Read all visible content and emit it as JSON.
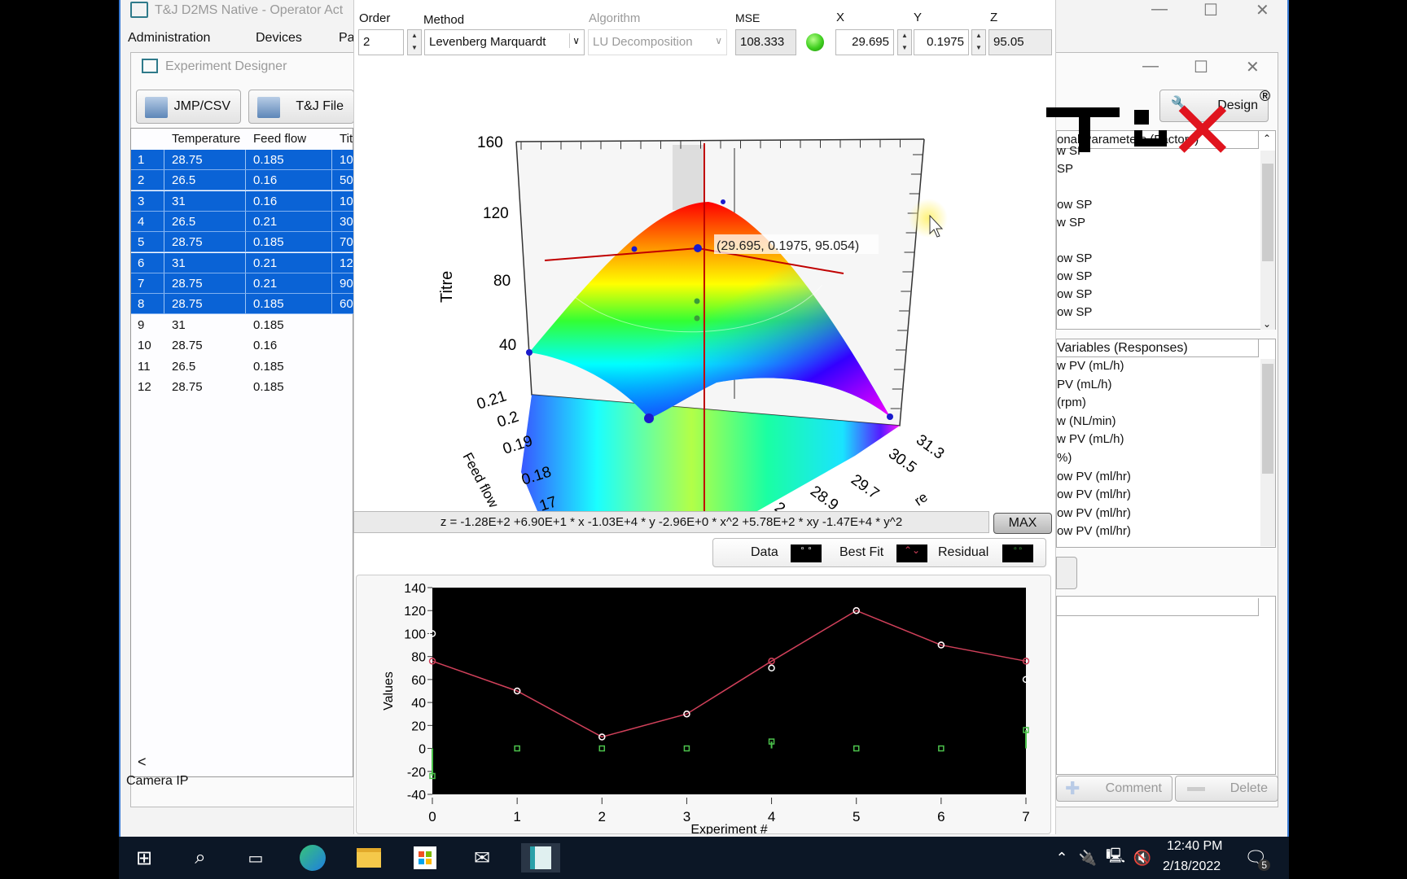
{
  "main_window": {
    "title": "T&J D2MS Native  - Operator Act",
    "menu": [
      "Administration",
      "Devices",
      "Pa"
    ],
    "camera_label": "Camera IP"
  },
  "designer": {
    "title": "Experiment Designer",
    "buttons": [
      "JMP/CSV",
      "T&J File"
    ],
    "columns": [
      "",
      "Temperature",
      "Feed flow",
      "Tit"
    ],
    "rows": [
      {
        "n": "1",
        "t": "28.75",
        "f": "0.185",
        "z": "10",
        "selected": true
      },
      {
        "n": "2",
        "t": "26.5",
        "f": "0.16",
        "z": "50",
        "selected": true
      },
      {
        "n": "3",
        "t": "31",
        "f": "0.16",
        "z": "10",
        "selected": true
      },
      {
        "n": "4",
        "t": "26.5",
        "f": "0.21",
        "z": "30",
        "selected": true
      },
      {
        "n": "5",
        "t": "28.75",
        "f": "0.185",
        "z": "70",
        "selected": true
      },
      {
        "n": "6",
        "t": "31",
        "f": "0.21",
        "z": "12",
        "selected": true
      },
      {
        "n": "7",
        "t": "28.75",
        "f": "0.21",
        "z": "90",
        "selected": true
      },
      {
        "n": "8",
        "t": "28.75",
        "f": "0.185",
        "z": "60",
        "selected": true
      },
      {
        "n": "9",
        "t": "31",
        "f": "0.185",
        "z": "",
        "selected": false
      },
      {
        "n": "10",
        "t": "28.75",
        "f": "0.16",
        "z": "",
        "selected": false
      },
      {
        "n": "11",
        "t": "26.5",
        "f": "0.185",
        "z": "",
        "selected": false
      },
      {
        "n": "12",
        "t": "28.75",
        "f": "0.185",
        "z": "",
        "selected": false
      }
    ],
    "scroll_left": "<"
  },
  "fit": {
    "order_label": "Order",
    "order": "2",
    "method_label": "Method",
    "method": "Levenberg Marquardt",
    "algorithm_label": "Algorithm",
    "algorithm": "LU Decomposition",
    "mse_label": "MSE",
    "mse": "108.333",
    "status_color": "#3fcf1f",
    "x_label": "X",
    "x": "29.695",
    "y_label": "Y",
    "y": "0.1975",
    "z_label": "Z",
    "z": "95.05",
    "equation": "z =  -1.28E+2 +6.90E+1 * x -1.03E+4 * y -2.96E+0 * x^2 +5.78E+2 * xy -1.47E+4 * y^2",
    "max_label": "MAX",
    "legend": [
      "Data",
      "Best Fit",
      "Residual"
    ]
  },
  "right": {
    "design_label": "Design",
    "list1_header": "onal Parameters (Factors)",
    "list1": [
      "w SP",
      "SP",
      "",
      "ow SP",
      "w SP",
      "",
      "ow SP",
      "ow SP",
      "ow SP",
      "ow SP"
    ],
    "list2_header": "Variables (Responses)",
    "list2": [
      "w PV (mL/h)",
      "PV (mL/h)",
      "(rpm)",
      "w (NL/min)",
      "w PV (mL/h)",
      "%)",
      "ow PV (ml/hr)",
      "ow PV (ml/hr)",
      "ow PV (ml/hr)",
      "ow PV (ml/hr)"
    ],
    "comment_label": "Comment",
    "delete_label": "Delete",
    "logo": "TUX"
  },
  "taskbar": {
    "time": "12:40 PM",
    "date": "2/18/2022",
    "notifications": "5"
  },
  "chart_data": [
    {
      "type": "surface",
      "zlabel": "Titre",
      "ylabel": "Feed flow",
      "xlabel": "re",
      "z_ticks": [
        "160",
        "120",
        "80",
        "40"
      ],
      "y_ticks": [
        "0.21",
        "0.2",
        "0.19",
        "0.18",
        "17"
      ],
      "x_ticks": [
        "31.3",
        "30.5",
        "29.7",
        "28.9",
        "2."
      ],
      "cursor_label": "(29.695, 0.1975, 95.054)",
      "colormap": [
        "#ff0000",
        "#ffff00",
        "#00ff66",
        "#00ffff",
        "#0000ff",
        "#ff00ff"
      ]
    },
    {
      "type": "line",
      "xlabel": "Experiment #",
      "ylabel": "Values",
      "xlim": [
        0,
        7
      ],
      "ylim": [
        -40,
        140
      ],
      "x_ticks": [
        "0",
        "1",
        "2",
        "3",
        "4",
        "5",
        "6",
        "7"
      ],
      "y_ticks": [
        "140",
        "120",
        "100",
        "80",
        "60",
        "40",
        "20",
        "0",
        "-20",
        "-40"
      ],
      "x": [
        0,
        1,
        2,
        3,
        4,
        5,
        6,
        7
      ],
      "series": [
        {
          "name": "Data",
          "values": [
            100,
            50,
            10,
            30,
            70,
            120,
            90,
            60
          ],
          "color": "#ffffff"
        },
        {
          "name": "Best Fit",
          "values": [
            76,
            50,
            10,
            30,
            76,
            120,
            90,
            76
          ],
          "color": "#d0405a"
        },
        {
          "name": "Residual",
          "values": [
            -24,
            0,
            0,
            0,
            6,
            0,
            0,
            16
          ],
          "color": "#4cc24c"
        }
      ]
    }
  ]
}
